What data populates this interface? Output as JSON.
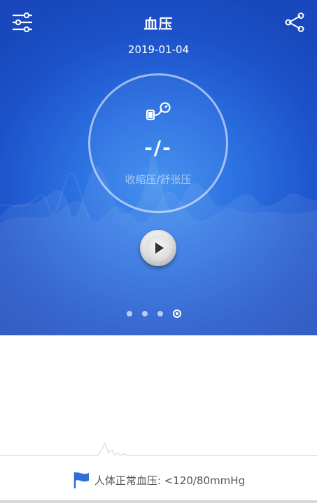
{
  "header": {
    "title": "血压",
    "settings_icon": "sliders-icon",
    "share_icon": "share-icon"
  },
  "measurement": {
    "date": "2019-01-04",
    "value": "-/-",
    "caption": "收缩压/舒张压",
    "icon": "blood-pressure-cuff-icon"
  },
  "controls": {
    "play_icon": "play-icon"
  },
  "pager": {
    "count": 4,
    "active_index": 3
  },
  "footer": {
    "flag_icon": "flag-icon",
    "normal_range_text": "人体正常血压: <120/80mmHg"
  },
  "colors": {
    "panel_blue": "#1c52c9",
    "panel_light_blue": "#3f8ef0",
    "flag_blue": "#2f6fd6",
    "text_gray": "#555555"
  }
}
